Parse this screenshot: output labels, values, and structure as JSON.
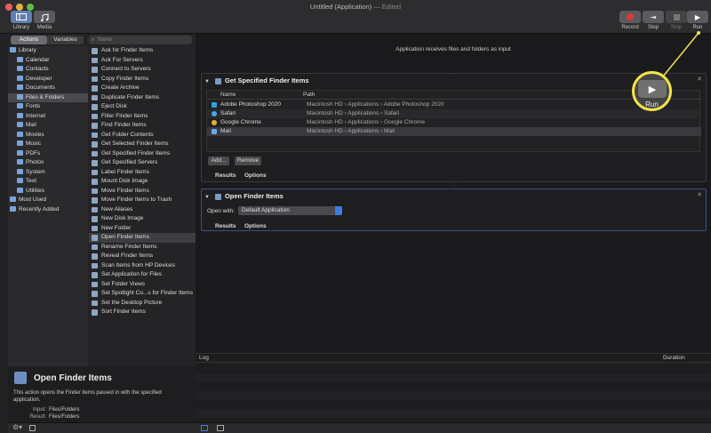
{
  "window": {
    "title": "Untitled (Application)",
    "edited": "— Edited"
  },
  "toolbar": {
    "library_label": "Library",
    "media_label": "Media",
    "record_label": "Record",
    "step_label": "Step",
    "stop_label": "Stop",
    "run_label": "Run"
  },
  "tabs": {
    "actions": "Actions",
    "variables": "Variables"
  },
  "search": {
    "placeholder": "Name"
  },
  "library": {
    "root": "Library",
    "items": [
      "Calendar",
      "Contacts",
      "Developer",
      "Documents",
      "Files & Folders",
      "Fonts",
      "Internet",
      "Mail",
      "Movies",
      "Music",
      "PDFs",
      "Photos",
      "System",
      "Text",
      "Utilities"
    ],
    "selected": "Files & Folders",
    "most_used": "Most Used",
    "recently_added": "Recently Added"
  },
  "actions": [
    "Ask for Finder Items",
    "Ask For Servers",
    "Connect to Servers",
    "Copy Finder Items",
    "Create Archive",
    "Duplicate Finder Items",
    "Eject Disk",
    "Filter Finder Items",
    "Find Finder Items",
    "Get Folder Contents",
    "Get Selected Finder Items",
    "Get Specified Finder Items",
    "Get Specified Servers",
    "Label Finder Items",
    "Mount Disk Image",
    "Move Finder Items",
    "Move Finder Items to Trash",
    "New Aliases",
    "New Disk Image",
    "New Folder",
    "Open Finder Items",
    "Rename Finder Items",
    "Reveal Finder Items",
    "Scan Items from HP Devices",
    "Set Application for Files",
    "Set Folder Views",
    "Set Spotlight Co...s for Finder Items",
    "Set the Desktop Picture",
    "Sort Finder Items"
  ],
  "selected_action": "Open Finder Items",
  "description": {
    "title": "Open Finder Items",
    "text": "This action opens the Finder items passed in with the specified application.",
    "input_label": "Input:",
    "input_value": "Files/Folders",
    "result_label": "Result:",
    "result_value": "Files/Folders"
  },
  "workflow": {
    "input_text": "Application receives files and folders as input",
    "card1": {
      "title": "Get Specified Finder Items",
      "col_name": "Name",
      "col_path": "Path",
      "rows": [
        {
          "name": "Adobe Photoshop 2020",
          "path": "Macintosh HD › Applications › Adobe Photoshop 2020"
        },
        {
          "name": "Safari",
          "path": "Macintosh HD › Applications › Safari"
        },
        {
          "name": "Google Chrome",
          "path": "Macintosh HD › Applications › Google Chrome"
        },
        {
          "name": "Mail",
          "path": "Macintosh HD › Applications › Mail"
        }
      ],
      "add_label": "Add...",
      "remove_label": "Remove",
      "results_tab": "Results",
      "options_tab": "Options"
    },
    "card2": {
      "title": "Open Finder Items",
      "open_with_label": "Open with:",
      "open_with_value": "Default Application",
      "results_tab": "Results",
      "options_tab": "Options"
    }
  },
  "log": {
    "col_log": "Log",
    "col_duration": "Duration"
  },
  "callout": {
    "label": "Run"
  },
  "colors": {
    "accent": "#3b7ee0",
    "callout": "#f2e44a",
    "record": "#d83a3a"
  }
}
